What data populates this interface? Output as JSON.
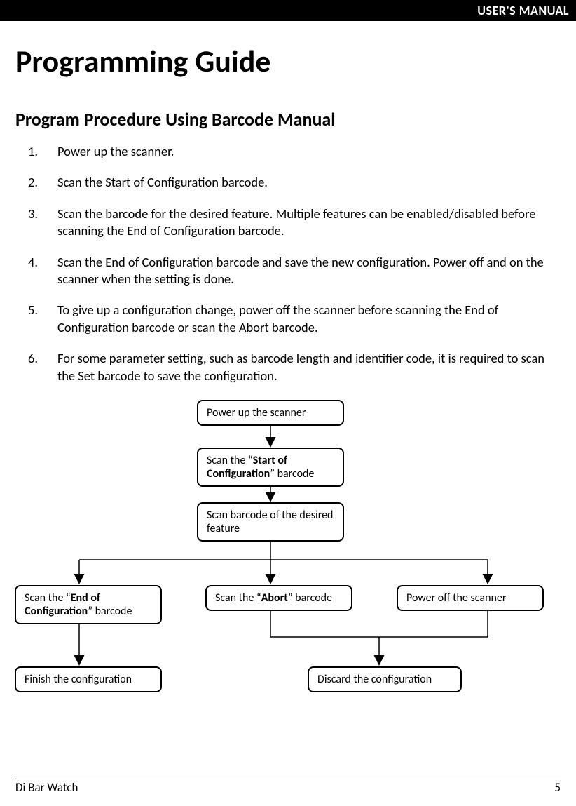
{
  "header": {
    "label": "USER'S MANUAL"
  },
  "title": "Programming Guide",
  "section": "Program Procedure Using Barcode Manual",
  "steps": [
    {
      "n": "1.",
      "t": "Power up the scanner."
    },
    {
      "n": "2.",
      "t": "Scan the Start of Configuration barcode."
    },
    {
      "n": "3.",
      "t": "Scan the barcode for the desired feature. Multiple features can be enabled/disabled before scanning the End of Configuration barcode."
    },
    {
      "n": "4.",
      "t": "Scan the End of Configuration barcode and save the new configuration. Power off and on the scanner when the setting is done."
    },
    {
      "n": "5.",
      "t": "To give up a configuration change, power off the scanner before scanning the End of Configuration barcode or scan the Abort barcode."
    },
    {
      "n": "6.",
      "t": "For some parameter setting, such as barcode length and identifier code, it is required to scan the Set barcode to save the configuration."
    }
  ],
  "flow": {
    "power_up": "Power up the scanner",
    "start_pre": "Scan the “",
    "start_bold": "Start of Configuration",
    "start_post": "” barcode",
    "feature": "Scan barcode of the desired feature",
    "end_pre": "Scan the “",
    "end_bold": "End of Configuration",
    "end_post": "” barcode",
    "abort_pre": "Scan the “",
    "abort_bold": "Abort",
    "abort_post": "” barcode",
    "power_off": "Power off the scanner",
    "finish": "Finish the configuration",
    "discard": "Discard the configuration"
  },
  "footer": {
    "left": "Di Bar Watch",
    "right": "5"
  }
}
